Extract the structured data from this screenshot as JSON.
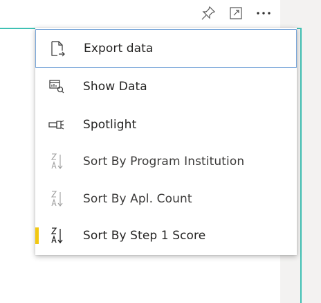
{
  "visual_header": {
    "pin_icon": "pin-icon",
    "focus_icon": "focus-mode-icon",
    "more_icon": "more-options-icon"
  },
  "menu": {
    "items": [
      {
        "label": "Export data",
        "icon": "export-icon",
        "focused": true
      },
      {
        "label": "Show Data",
        "icon": "table-chart-icon"
      },
      {
        "label": "Spotlight",
        "icon": "spotlight-icon"
      },
      {
        "label": "Sort By Program Institution",
        "icon": "sort-za-icon"
      },
      {
        "label": "Sort By Apl. Count",
        "icon": "sort-za-icon"
      },
      {
        "label": "Sort By Step 1 Score",
        "icon": "sort-za-icon",
        "active": true
      }
    ]
  },
  "colors": {
    "accent": "#3fc1b4",
    "active_indicator": "#f2c811",
    "focus_border": "#7aa7d9"
  }
}
